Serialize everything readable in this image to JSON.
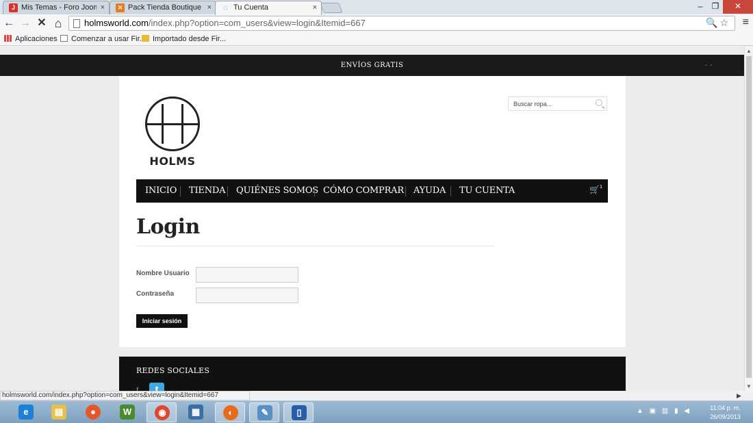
{
  "browser": {
    "tabs": [
      {
        "title": "Mis Temas - Foro Joomla!",
        "favicon_color": "#d9322c",
        "favicon_glyph": "J"
      },
      {
        "title": "Pack Tienda Boutique - A",
        "favicon_color": "#e87a22",
        "favicon_glyph": "✕"
      },
      {
        "title": "Tu Cuenta",
        "favicon_color": "#4a90d9",
        "favicon_glyph": "◌"
      }
    ],
    "tab_close_glyph": "×",
    "window_buttons": {
      "minimize": "–",
      "restore": "❐",
      "close": "✕"
    },
    "nav": {
      "back": "←",
      "forward": "→",
      "stop": "✕",
      "home": "⌂"
    },
    "url_host": "holmsworld.com",
    "url_path": "/index.php?option=com_users&view=login&Itemid=667",
    "omnibox_icons": "🔍☆",
    "menu_glyph": "≡",
    "bookmarks": [
      {
        "label": "Aplicaciones",
        "icon": "apps-icon"
      },
      {
        "label": "Comenzar a usar Fir...",
        "icon": "page-icon"
      },
      {
        "label": "Importado desde Fir...",
        "icon": "folder-icon"
      }
    ],
    "status_url": "holmsworld.com/index.php?option=com_users&view=login&Itemid=667"
  },
  "site": {
    "topbar_text": "ENVÍOS GRATIS",
    "topbar_right": "- -",
    "search_placeholder": "Buscar ropa...",
    "logo_text": "HOLMS",
    "nav_items": [
      "INICIO",
      "TIENDA",
      "QUIÉNES SOMOS",
      "CÓMO COMPRAR",
      "AYUDA",
      "TU CUENTA"
    ],
    "cart_glyph": "🛒",
    "cart_count": "1",
    "page_title": "Login",
    "form": {
      "username_label": "Nombre Usuario",
      "username_value": "",
      "password_label": "Contraseña",
      "password_value": "",
      "submit_label": "Iniciar sesión"
    },
    "footer_title": "REDES SOCIALES",
    "footer_fb": "f",
    "footer_tw": "t"
  },
  "taskbar": {
    "apps": [
      {
        "name": "internet-explorer",
        "glyph": "e",
        "color": "#1e7fd6",
        "active": false
      },
      {
        "name": "file-explorer",
        "glyph": "▤",
        "color": "#e9c14a",
        "active": false
      },
      {
        "name": "app-orange",
        "glyph": "●",
        "color": "#e5572b",
        "active": false
      },
      {
        "name": "webmatrix",
        "glyph": "W",
        "color": "#4c8a2e",
        "active": false
      },
      {
        "name": "chrome",
        "glyph": "◉",
        "color": "#e0452f",
        "active": true
      },
      {
        "name": "network-app",
        "glyph": "▦",
        "color": "#3a6ea5",
        "active": false
      },
      {
        "name": "firefox",
        "glyph": "◐",
        "color": "#e66b1a",
        "active": false
      },
      {
        "name": "notepad",
        "glyph": "✎",
        "color": "#5a8fc4",
        "active": false
      },
      {
        "name": "device-app",
        "glyph": "▯",
        "color": "#2a5da8",
        "active": false
      }
    ],
    "tray_icons": "▲ ▣ ▥ ▮ ◀",
    "time": "11:04 p. m.",
    "date": "26/09/2013"
  }
}
